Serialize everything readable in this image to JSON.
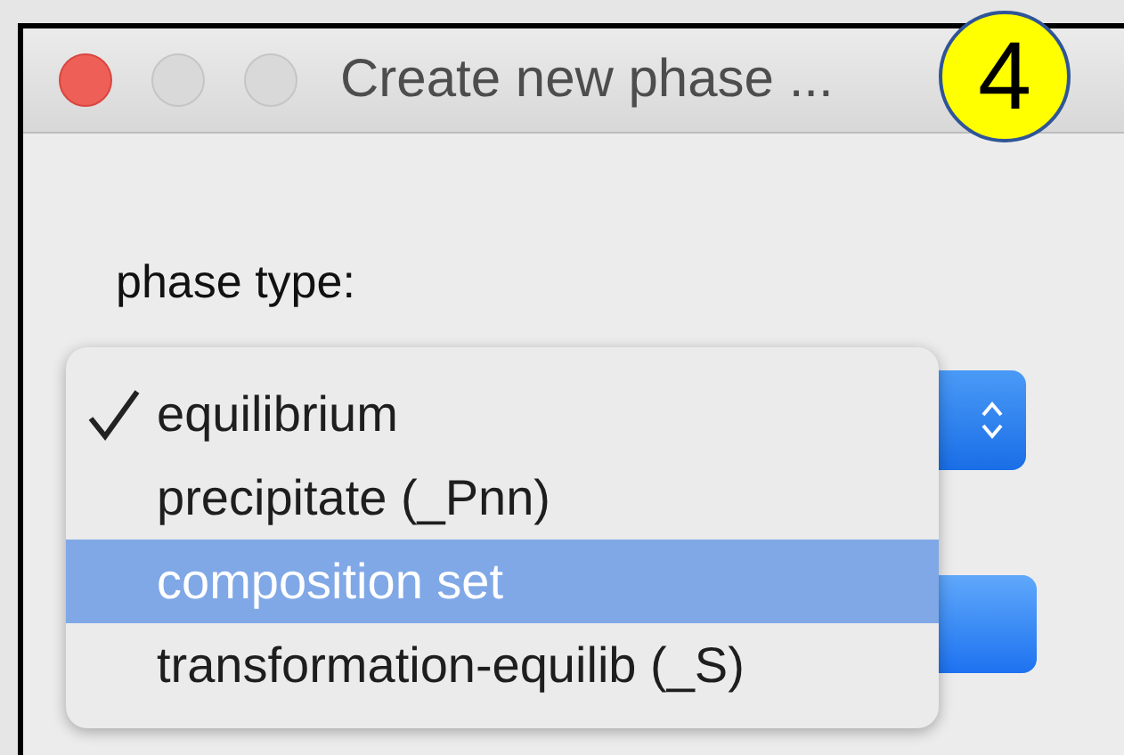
{
  "window": {
    "title": "Create new phase ..."
  },
  "badge": {
    "text": "4"
  },
  "phase_type": {
    "label": "phase type:"
  },
  "menu": {
    "items": [
      {
        "label": "equilibrium",
        "checked": true,
        "selected": false
      },
      {
        "label": "precipitate (_Pnn)",
        "checked": false,
        "selected": false
      },
      {
        "label": "composition set",
        "checked": false,
        "selected": true
      },
      {
        "label": "transformation-equilib (_S)",
        "checked": false,
        "selected": false
      }
    ]
  }
}
